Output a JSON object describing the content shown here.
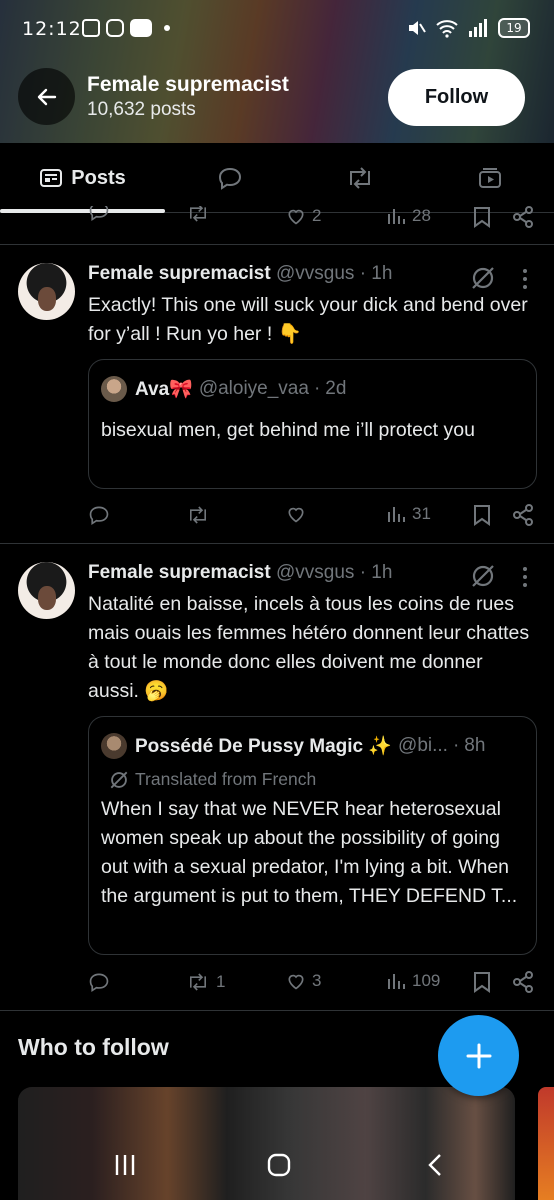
{
  "status_bar": {
    "time": "12:12",
    "battery": "19"
  },
  "header": {
    "title": "Female supremacist",
    "subtitle": "10,632 posts",
    "follow_label": "Follow"
  },
  "tabs": [
    {
      "label": "Posts",
      "icon": "posts-icon",
      "selected": true
    },
    {
      "label": "",
      "icon": "reply-icon"
    },
    {
      "label": "",
      "icon": "repost-icon"
    },
    {
      "label": "",
      "icon": "media-icon"
    }
  ],
  "top_partial_actions": {
    "reply": "",
    "repost": "",
    "likes": "2",
    "views": "28"
  },
  "posts": [
    {
      "name": "Female supremacist",
      "handle": "@vvsgus",
      "time": "1h",
      "text": "Exactly! This one will suck your dick and bend over for y’all ! Run yo her ! 👇",
      "quote": {
        "name": "Ava🎀",
        "handle": "@aloiye_vaa",
        "time": "2d",
        "text": "bisexual men, get behind me i’ll protect you"
      },
      "actions": {
        "reply": "",
        "repost": "",
        "likes": "",
        "views": "31"
      }
    },
    {
      "name": "Female supremacist",
      "handle": "@vvsgus",
      "time": "1h",
      "text": "Natalité en baisse, incels à tous les coins de rues mais ouais les femmes hétéro donnent leur chattes à tout le monde donc elles doivent me donner aussi. 🥱",
      "quote": {
        "name": "Possédé De Pussy Magic ✨",
        "handle": "@bi...",
        "time": "8h",
        "translated": "Translated from French",
        "text": "When I say that we NEVER hear heterosexual women speak up about the possibility of going out with a sexual predator, I'm lying a bit. When the argument is put to them, THEY DEFEND T..."
      },
      "actions": {
        "reply": "",
        "repost": "1",
        "likes": "3",
        "views": "109"
      }
    }
  ],
  "who_to_follow": {
    "title": "Who to follow"
  },
  "colors": {
    "accent": "#1d9bf0",
    "muted": "#71767b",
    "text": "#e7e9ea",
    "border": "#2f3336"
  }
}
